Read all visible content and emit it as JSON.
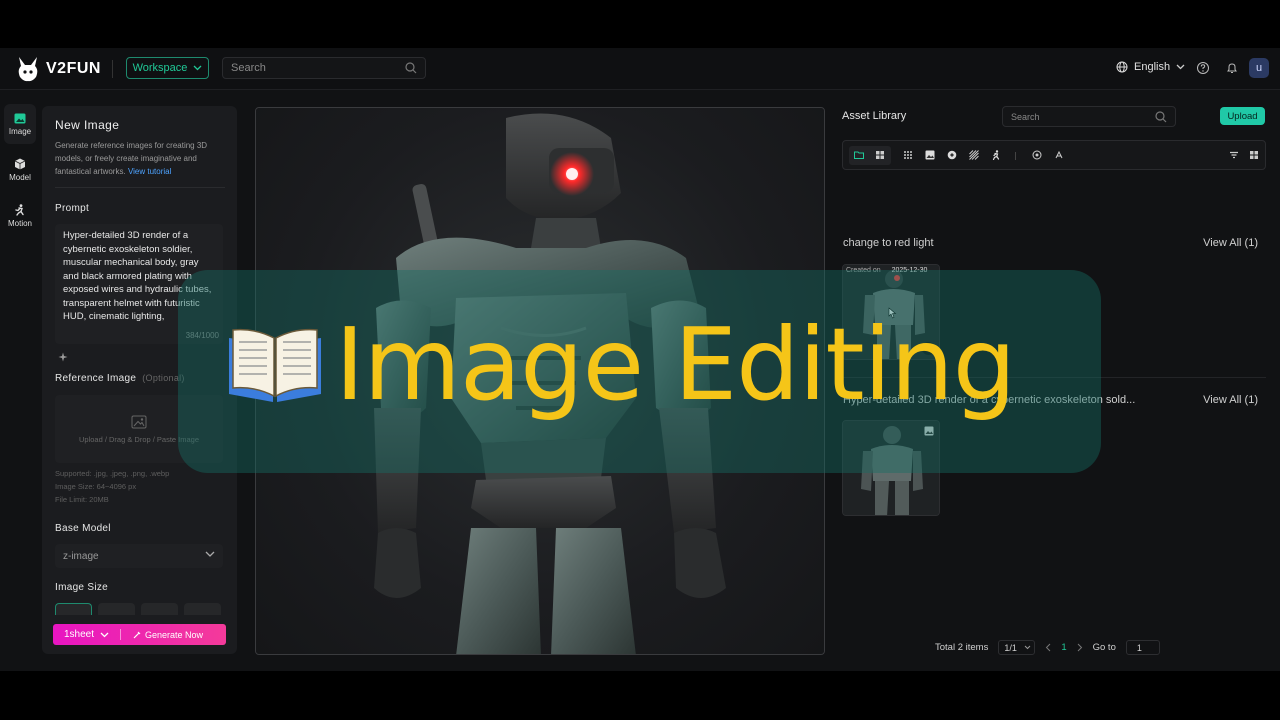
{
  "app": {
    "brand": "V2FUN",
    "workspace_label": "Workspace",
    "search_placeholder": "Search",
    "language": "English",
    "avatar_initial": "u"
  },
  "nav": [
    {
      "label": "Image",
      "icon": "image-icon",
      "active": true
    },
    {
      "label": "Model",
      "icon": "cube-icon"
    },
    {
      "label": "Motion",
      "icon": "running-person-icon"
    }
  ],
  "panel": {
    "title": "New Image",
    "description": "Generate reference images for creating 3D models, or freely create imaginative and fantastical artworks.",
    "tutorial_link": "View tutorial",
    "prompt_label": "Prompt",
    "prompt_text": "Hyper-detailed 3D render of a cybernetic exoskeleton soldier, muscular mechanical body, gray and black armored plating with exposed wires and hydraulic tubes, transparent helmet with futuristic HUD, cinematic lighting,",
    "prompt_counter": "384/1000",
    "reference_label": "Reference Image",
    "reference_optional": "(Optional)",
    "upload_hint": "Upload / Drag & Drop / Paste Image",
    "supported": "Supported: .jpg, .jpeg, .png, .webp",
    "image_size_spec": "Image Size: 64~4096 px",
    "file_limit": "File Limit: 20MB",
    "base_model_label": "Base Model",
    "base_model_value": "z-image",
    "image_size_label": "Image Size",
    "sheet_label": "1sheet",
    "generate_label": "Generate Now"
  },
  "library": {
    "title": "Asset Library",
    "search_placeholder": "Search",
    "upload_label": "Upload",
    "groups": [
      {
        "title": "change to red light",
        "view_all": "View All (1)",
        "created_prefix": "Created on",
        "created_date": "2025-12-30"
      },
      {
        "title": "Hyper-detailed 3D render of a cybernetic exoskeleton sold...",
        "view_all": "View All (1)"
      }
    ],
    "pager": {
      "total": "Total 2 items",
      "page_select": "1/1",
      "current": "1",
      "goto_label": "Go to",
      "goto_value": "1"
    }
  },
  "overlay": {
    "title": "Image Editing",
    "icon": "open-book-icon"
  },
  "colors": {
    "accent": "#20c997",
    "generate_gradient_start": "#e815c2",
    "generate_gradient_end": "#f43a9a",
    "overlay_text": "#f5c518",
    "hud_red": "#ff2a2a"
  }
}
